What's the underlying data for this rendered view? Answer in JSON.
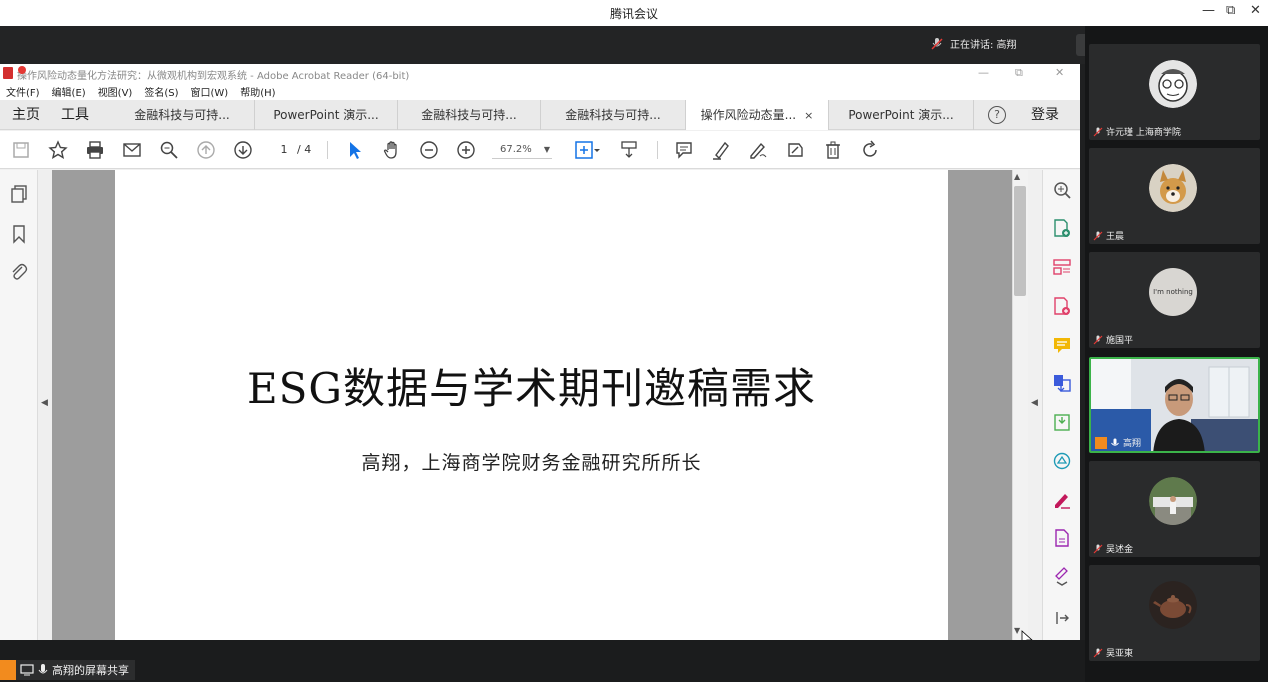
{
  "window": {
    "title": "腾讯会议",
    "controls": [
      "—",
      "⧉",
      "✕"
    ]
  },
  "meeting": {
    "speaking_label": "正在讲话: 高翔",
    "share_label": "高翔的屏幕共享"
  },
  "acrobat": {
    "title": "操作风险动态量化方法研究：从微观机构到宏观系统 - Adobe Acrobat Reader (64-bit)",
    "recording_label": "录制中",
    "menus": [
      "文件(F)",
      "编辑(E)",
      "视图(V)",
      "签名(S)",
      "窗口(W)",
      "帮助(H)"
    ],
    "nav": {
      "home": "主页",
      "tools": "工具",
      "help": "?",
      "login": "登录"
    },
    "tabs": [
      {
        "label": "金融科技与可持..."
      },
      {
        "label": "PowerPoint 演示..."
      },
      {
        "label": "金融科技与可持..."
      },
      {
        "label": "金融科技与可持..."
      },
      {
        "label": "操作风险动态量...",
        "active": true,
        "close": "×"
      },
      {
        "label": "PowerPoint 演示..."
      }
    ],
    "toolbar": {
      "page_current": "1",
      "page_total": "/ 4",
      "zoom": "67.2%"
    },
    "document": {
      "title": "ESG数据与学术期刊邀稿需求",
      "subtitle": "高翔，上海商学院财务金融研究所所长"
    }
  },
  "participants": [
    {
      "name": "许元瑾 上海商学院",
      "avatar": "cartoon-face"
    },
    {
      "name": "王晨",
      "avatar": "dog"
    },
    {
      "name": "施国平",
      "avatar": "im-nothing",
      "avatar_text": "I'm nothing"
    },
    {
      "name": "高翔",
      "avatar": "video",
      "active": true
    },
    {
      "name": "吴述金",
      "avatar": "person-outdoor"
    },
    {
      "name": "吴亚東",
      "avatar": "teapot"
    }
  ],
  "colors": {
    "accent_blue": "#1473e6",
    "speaking_green": "#3bb34a",
    "host_orange": "#f28b1e"
  }
}
